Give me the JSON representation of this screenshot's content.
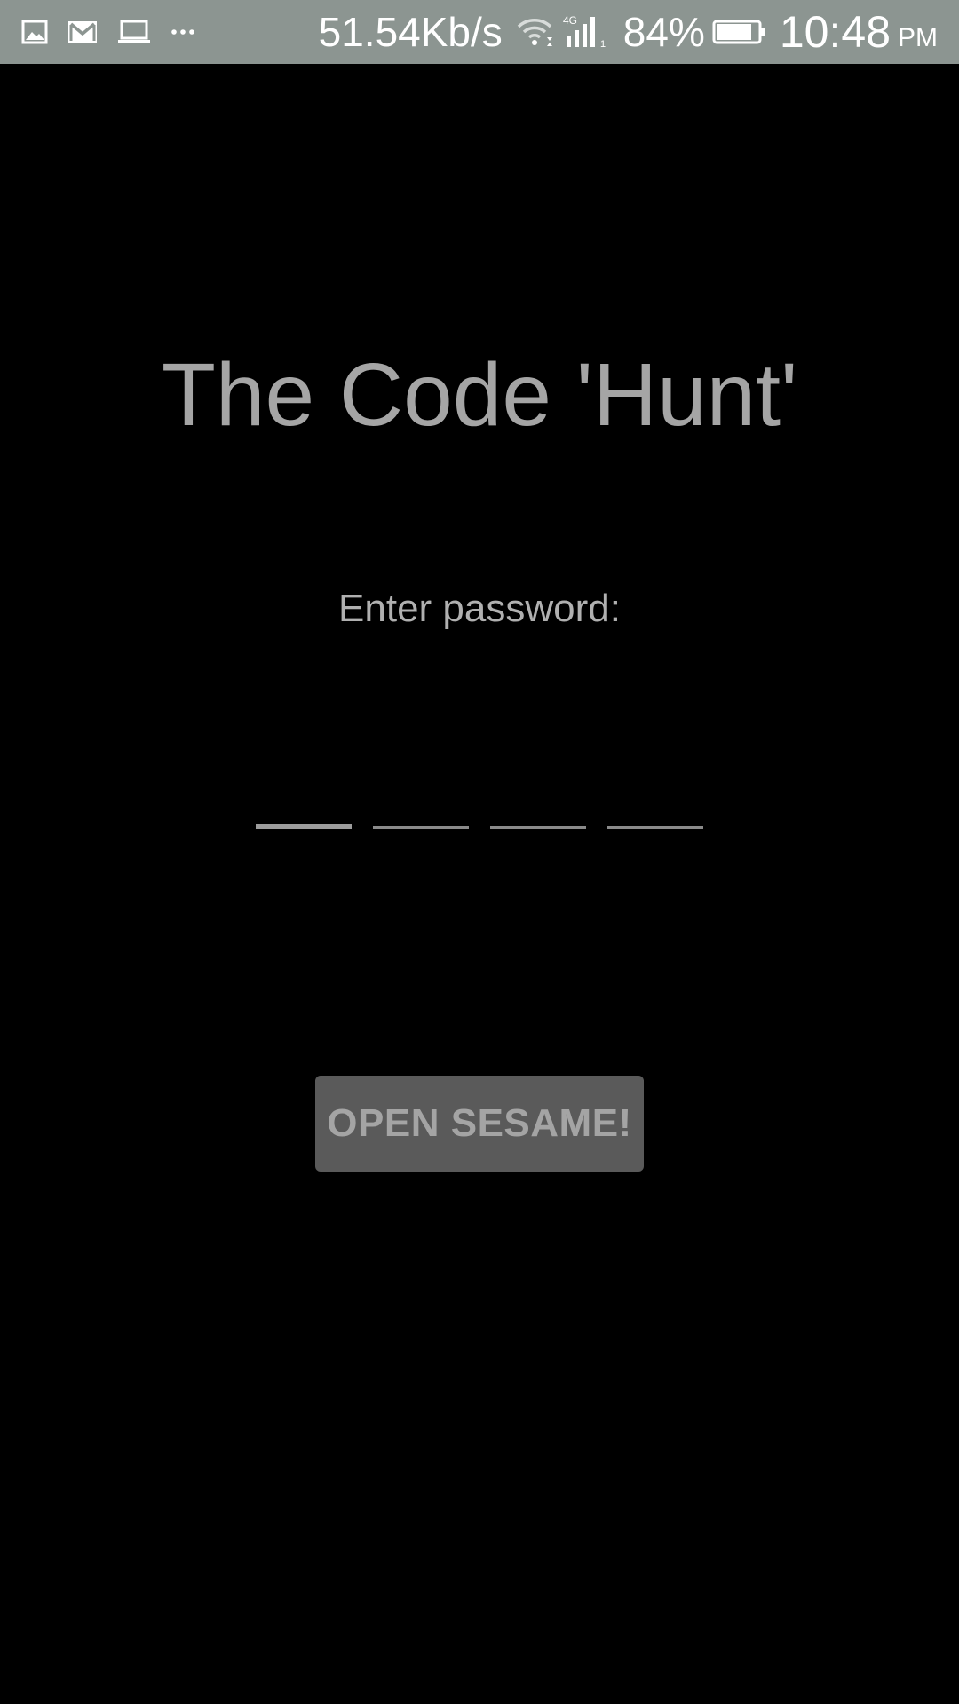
{
  "status_bar": {
    "icons_left": [
      "image-icon",
      "gmail-icon",
      "laptop-icon",
      "more-dots-icon"
    ],
    "more_text": "···",
    "network_speed": "51.54Kb/s",
    "network_type": "4G",
    "battery_percent": "84%",
    "battery_level": 0.84,
    "time": "10:48",
    "ampm": "PM",
    "background_color": "#8c9591"
  },
  "app": {
    "title": "The Code 'Hunt'",
    "password_label": "Enter password:",
    "pin_fields": [
      "",
      "",
      "",
      ""
    ],
    "submit_label": "OPEN SESAME!"
  },
  "colors": {
    "background": "#000000",
    "text": "#a5a5a5",
    "button": "#5a5a5a"
  }
}
